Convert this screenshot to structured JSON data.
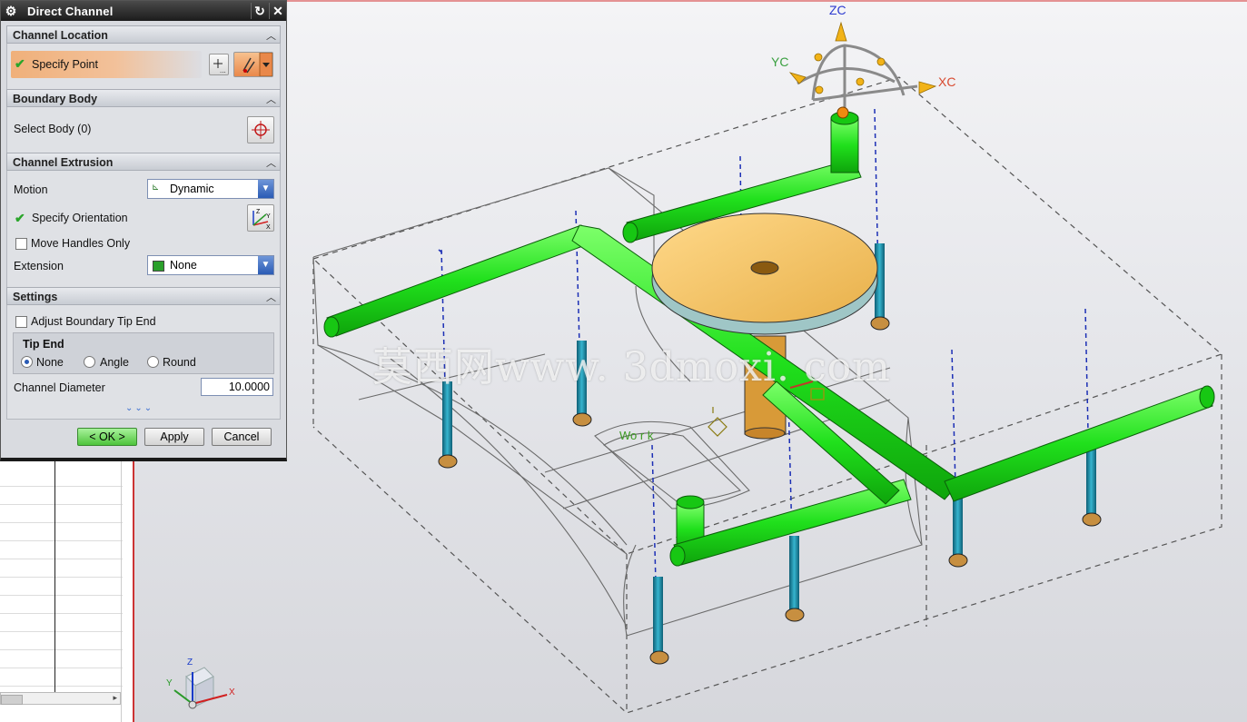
{
  "dialog": {
    "title": "Direct Channel",
    "sections": {
      "channel_location": {
        "title": "Channel Location",
        "specify_point": "Specify Point"
      },
      "boundary_body": {
        "title": "Boundary Body",
        "select_body": "Select Body (0)"
      },
      "channel_extrusion": {
        "title": "Channel Extrusion",
        "motion_label": "Motion",
        "motion_value": "Dynamic",
        "specify_orientation": "Specify Orientation",
        "move_handles_only": "Move Handles Only",
        "move_handles_only_checked": false,
        "extension_label": "Extension",
        "extension_value": "None"
      },
      "settings": {
        "title": "Settings",
        "adjust_boundary_tip_end": "Adjust Boundary Tip End",
        "adjust_boundary_tip_end_checked": false,
        "tip_end_title": "Tip End",
        "tip_end_options": [
          "None",
          "Angle",
          "Round"
        ],
        "tip_end_selected": "None",
        "channel_diameter_label": "Channel Diameter",
        "channel_diameter_value": "10.0000"
      }
    },
    "buttons": {
      "ok": "< OK >",
      "apply": "Apply",
      "cancel": "Cancel"
    },
    "icons": [
      "gear-icon",
      "reset-icon",
      "close-icon",
      "point-constructor-icon",
      "inferred-point-icon",
      "crosshair-icon",
      "csys-icon",
      "dynamic-csys-icon",
      "extension-icon",
      "expand-more-icon"
    ]
  },
  "viewport": {
    "watermark": "莫西网www. 3dmoxi. com",
    "handle_axes": {
      "x": "XC",
      "y": "YC",
      "z": "ZC"
    },
    "triad_axes": {
      "x": "X",
      "y": "Y",
      "z": "Z"
    },
    "work_label": "Wo r k",
    "colors": {
      "channel": "#22e61e",
      "baffle": "#1f8fa8",
      "disk": "#f2c262",
      "accent": "#e9884a",
      "title_bar": "#2a2a2a"
    }
  }
}
